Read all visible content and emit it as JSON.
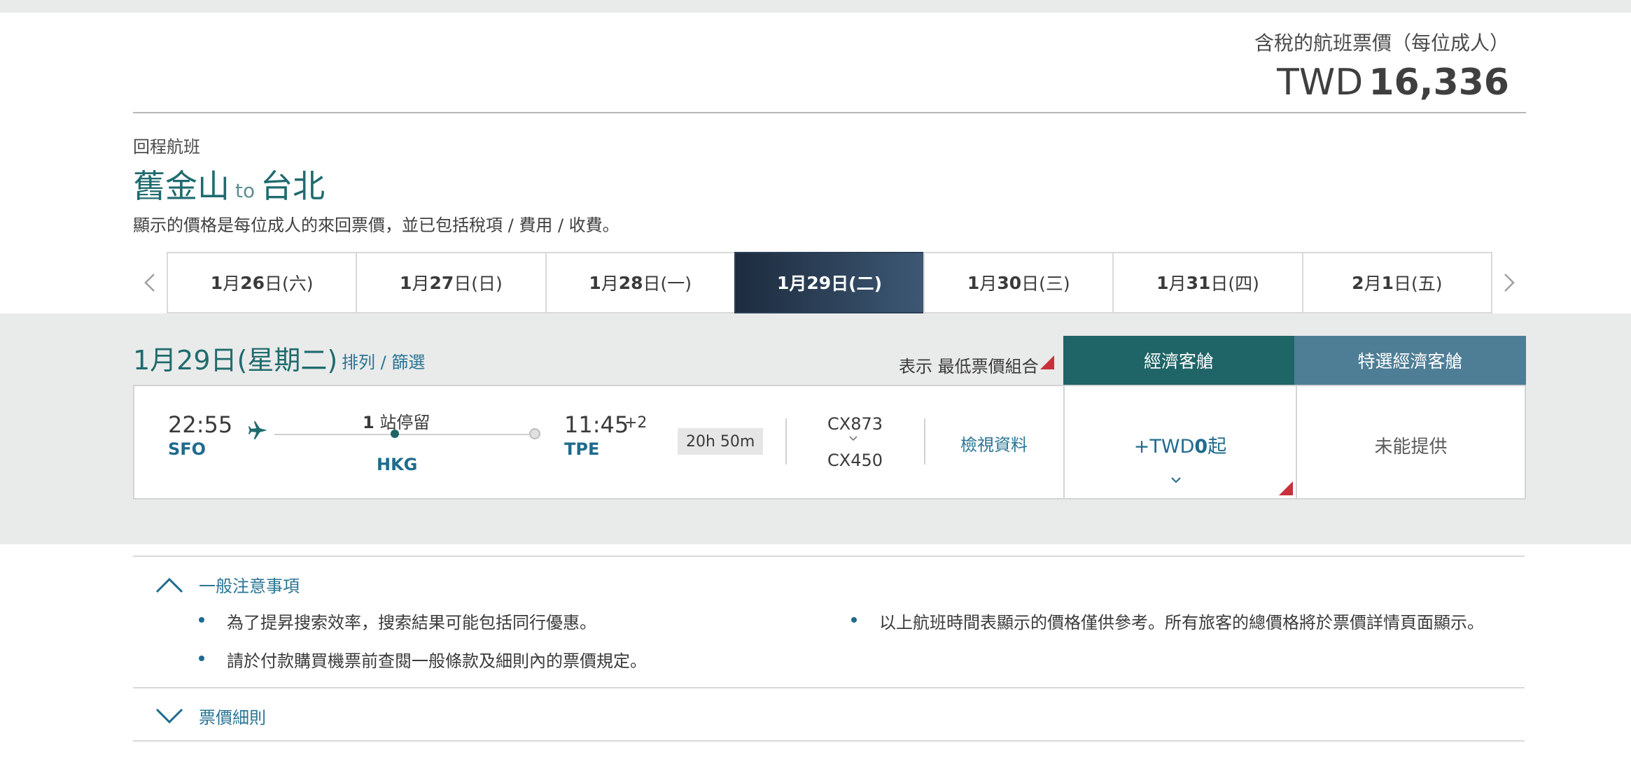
{
  "fare_summary": {
    "label": "含稅的航班票價（每位成人）",
    "currency": "TWD",
    "amount": "16,336"
  },
  "section": {
    "label": "回程航班",
    "origin": "舊金山",
    "to": "to",
    "destination": "台北",
    "note": "顯示的價格是每位成人的來回票價，並已包括稅項 / 費用 / 收費。"
  },
  "date_tabs": [
    {
      "num": "1",
      "mid": "月",
      "day": "26",
      "rest": "日(六)"
    },
    {
      "num": "1",
      "mid": "月",
      "day": "27",
      "rest": "日(日)"
    },
    {
      "num": "1",
      "mid": "月",
      "day": "28",
      "rest": "日(一)"
    },
    {
      "num": "1",
      "mid": "月",
      "day": "29",
      "rest": "日(二)"
    },
    {
      "num": "1",
      "mid": "月",
      "day": "30",
      "rest": "日(三)"
    },
    {
      "num": "1",
      "mid": "月",
      "day": "31",
      "rest": "日(四)"
    },
    {
      "num": "2",
      "mid": "月",
      "day": "1",
      "rest": "日(五)"
    }
  ],
  "results": {
    "day_title": "1月29日(星期二)",
    "sort_filter": "排列 / 篩選",
    "legend": "表示 最低票價組合",
    "cabin_economy": "經濟客艙",
    "cabin_premium": "特選經濟客艙"
  },
  "flight": {
    "dep_time": "22:55",
    "dep_code": "SFO",
    "stops_count": "1",
    "stops_text": " 站停留",
    "stop_code": "HKG",
    "arr_time": "11:45",
    "arr_plus": "+2",
    "arr_code": "TPE",
    "duration": "20h 50m",
    "flight_no_1": "CX873",
    "flight_no_2": "CX450",
    "details_link": "檢視資料",
    "economy_prefix": "+TWD",
    "economy_amount": "0",
    "economy_suffix": "起",
    "premium_status": "未能提供"
  },
  "notes": {
    "general_title": "一般注意事項",
    "items": [
      "為了提昇搜索效率，搜索結果可能包括同行優惠。",
      "請於付款購買機票前查閱一般條款及細則內的票價規定。",
      "以上航班時間表顯示的價格僅供參考。所有旅客的總價格將於票價詳情頁面顯示。"
    ],
    "fare_rules_title": "票價細則"
  },
  "colors": {
    "brand_teal": "#1f6b6e",
    "link_blue": "#2a7494",
    "economy_header": "#1f6466",
    "premium_header": "#4e7d96",
    "lowest_fare_marker": "#c8313c"
  }
}
